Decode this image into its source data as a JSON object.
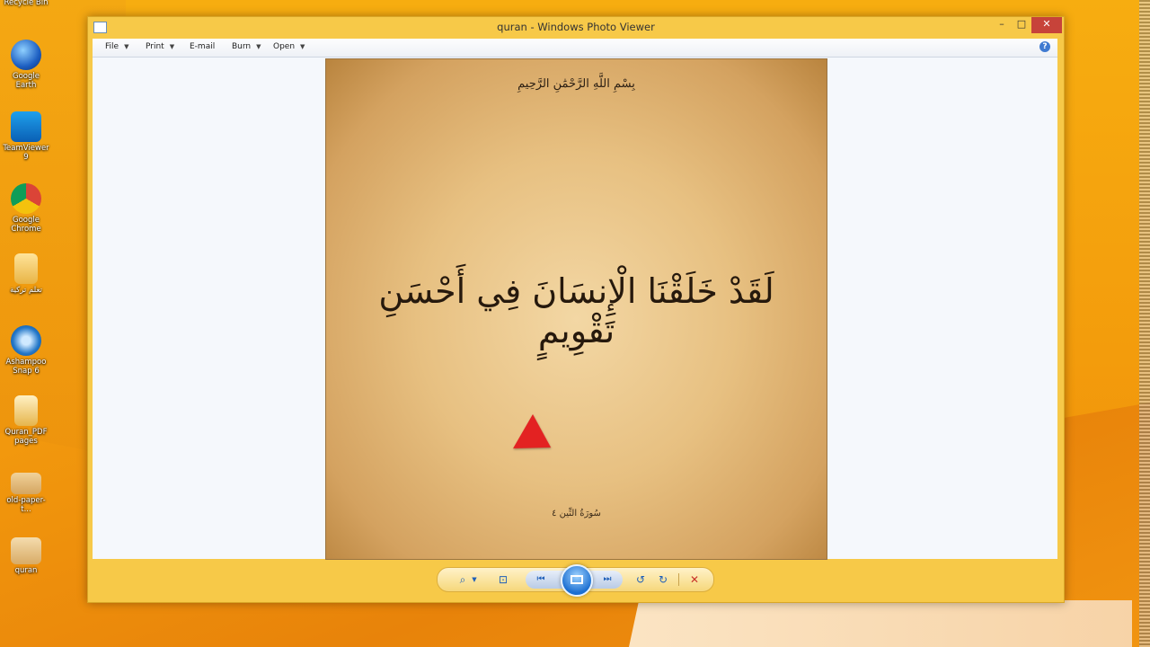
{
  "window": {
    "title": "quran - Windows Photo Viewer"
  },
  "menu": {
    "file": "File",
    "print": "Print",
    "email": "E-mail",
    "burn": "Burn",
    "open": "Open",
    "help": "?"
  },
  "photo": {
    "basmala": "بِسْمِ اللَّهِ الرَّحْمَٰنِ الرَّحِيمِ",
    "verse": "لَقَدْ خَلَقْنَا الْإِنسَانَ فِي أَحْسَنِ تَقْوِيمٍ",
    "surah_label": "سُورَةُ التِّين ٤"
  },
  "desktop": {
    "icons": [
      {
        "label": "Recycle Bin",
        "icon": "recycle-bin-icon"
      },
      {
        "label": "Google Earth",
        "icon": "google-earth-icon"
      },
      {
        "label": "TeamViewer 9",
        "icon": "teamviewer-icon"
      },
      {
        "label": "Google Chrome",
        "icon": "chrome-icon"
      },
      {
        "label": "تعلم تركية",
        "icon": "folder-icon"
      },
      {
        "label": "Ashampoo Snap 6",
        "icon": "ashampoo-snap-icon"
      },
      {
        "label": "Quran_PDF pages",
        "icon": "folder-icon"
      },
      {
        "label": "old-paper-t...",
        "icon": "image-file-icon"
      },
      {
        "label": "quran",
        "icon": "image-file-icon"
      }
    ]
  },
  "toolbar": {
    "zoom": "⌕",
    "actual_size": "⊡",
    "previous": "⏮",
    "next": "⏭",
    "rotate_ccw": "↺",
    "rotate_cw": "↻",
    "delete": "✕"
  },
  "colors": {
    "desktop_orange": "#f39c0c",
    "window_frame": "#f7c948",
    "close_button": "#c7433a",
    "cursor_red": "#e32222"
  }
}
